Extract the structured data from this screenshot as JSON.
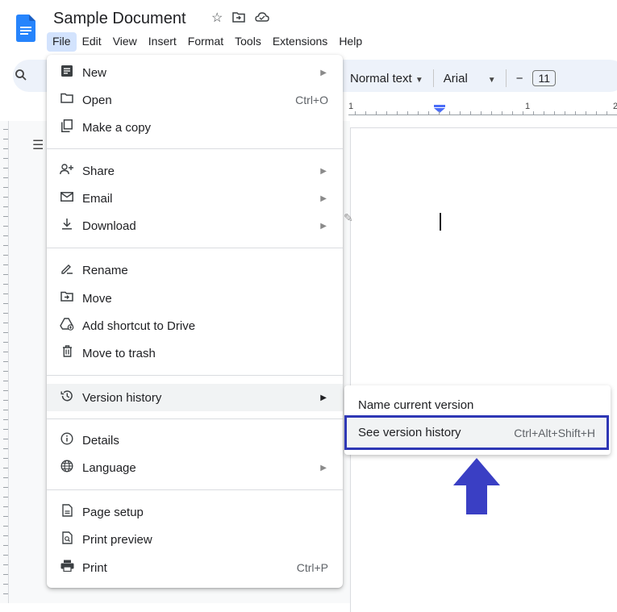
{
  "document": {
    "title": "Sample Document",
    "title_icons": [
      "star-icon",
      "move-folder-icon",
      "cloud-status-icon"
    ]
  },
  "menubar": {
    "items": [
      "File",
      "Edit",
      "View",
      "Insert",
      "Format",
      "Tools",
      "Extensions",
      "Help"
    ],
    "active": "File"
  },
  "toolbar": {
    "search_icon": "search-icon",
    "paragraph_style": "Normal text",
    "font": "Arial",
    "font_size_decrease": "−",
    "font_size": "11"
  },
  "ruler": {
    "numbers": [
      "1",
      "1",
      "2"
    ]
  },
  "file_menu": {
    "items": [
      {
        "label": "New",
        "icon": "new-doc-icon",
        "submenu": true
      },
      {
        "label": "Open",
        "icon": "folder-icon",
        "shortcut": "Ctrl+O"
      },
      {
        "label": "Make a copy",
        "icon": "copy-icon"
      },
      {
        "label": "Share",
        "icon": "share-person-icon",
        "submenu": true
      },
      {
        "label": "Email",
        "icon": "email-icon",
        "submenu": true
      },
      {
        "label": "Download",
        "icon": "download-icon",
        "submenu": true
      },
      {
        "label": "Rename",
        "icon": "rename-icon"
      },
      {
        "label": "Move",
        "icon": "move-icon"
      },
      {
        "label": "Add shortcut to Drive",
        "icon": "drive-shortcut-icon"
      },
      {
        "label": "Move to trash",
        "icon": "trash-icon"
      },
      {
        "label": "Version history",
        "icon": "history-icon",
        "submenu": true,
        "highlighted": true
      },
      {
        "label": "Details",
        "icon": "info-icon"
      },
      {
        "label": "Language",
        "icon": "globe-icon",
        "submenu": true
      },
      {
        "label": "Page setup",
        "icon": "page-setup-icon"
      },
      {
        "label": "Print preview",
        "icon": "print-preview-icon"
      },
      {
        "label": "Print",
        "icon": "printer-icon",
        "shortcut": "Ctrl+P"
      }
    ]
  },
  "version_submenu": {
    "items": [
      {
        "label": "Name current version"
      },
      {
        "label": "See version history",
        "shortcut": "Ctrl+Alt+Shift+H",
        "highlighted": true
      }
    ]
  },
  "colors": {
    "accent_box": "#2e37b5",
    "arrow": "#3a3fc4",
    "active_menu": "#d3e3fd",
    "toolbar_bg": "#edf2fa",
    "doc_logo": "#2684fc"
  }
}
